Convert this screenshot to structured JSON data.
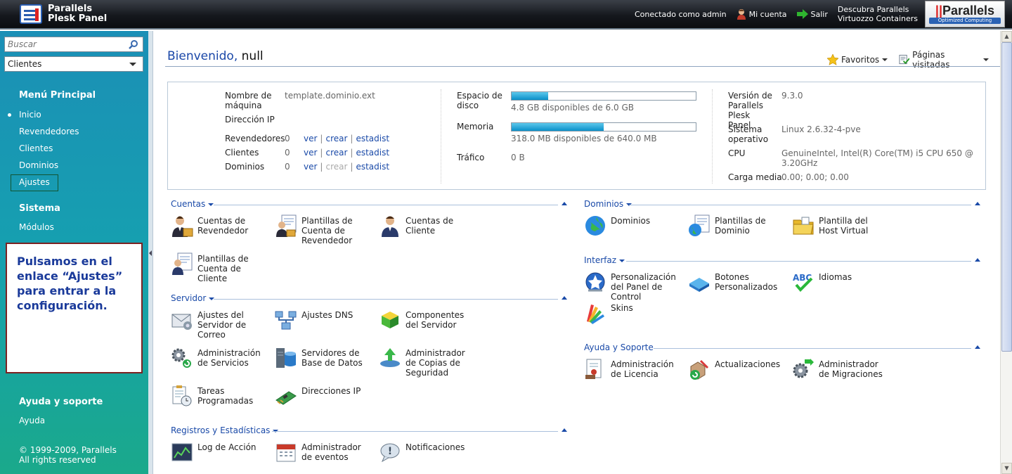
{
  "app": {
    "title_line1": "Parallels",
    "title_line2": "Plesk Panel"
  },
  "topbar": {
    "connected": "Conectado como admin",
    "account": "Mi cuenta",
    "logout": "Salir",
    "discover_line1": "Descubra Parallels",
    "discover_line2": "Virtuozzo Containers",
    "brand_name": "Parallels",
    "brand_tag": "Optimized Computing"
  },
  "sidebar": {
    "search_placeholder": "Buscar",
    "select_value": "Clientes",
    "main_menu": "Menú Principal",
    "main_items": [
      "Inicio",
      "Revendedores",
      "Clientes",
      "Dominios",
      "Ajustes"
    ],
    "system": "Sistema",
    "system_items": [
      "Módulos"
    ],
    "note": "Pulsamos en el enlace “Ajustes” para entrar a la configuración.",
    "help": "Ayuda y soporte",
    "help_items": [
      "Ayuda"
    ],
    "copyright_line1": "© 1999-2009, Parallels",
    "copyright_line2": "All rights reserved"
  },
  "main": {
    "welcome": "Bienvenido,",
    "user": "null",
    "favorites": "Favoritos",
    "visited": "Páginas visitadas"
  },
  "info": {
    "host_label": "Nombre de máquina",
    "host_value": "template.dominio.ext",
    "ip_label": "Dirección IP",
    "rows": [
      {
        "label": "Revendedores",
        "count": "0",
        "ver": "ver",
        "crear": "crear",
        "estadist": "estadist"
      },
      {
        "label": "Clientes",
        "count": "0",
        "ver": "ver",
        "crear": "crear",
        "estadist": "estadist"
      },
      {
        "label": "Dominios",
        "count": "0",
        "ver": "ver",
        "crear": "crear",
        "estadist": "estadist"
      }
    ],
    "disk_label": "Espacio de disco",
    "disk_value": "4.8 GB disponibles de 6.0 GB",
    "disk_used_fraction": 0.2,
    "mem_label": "Memoria",
    "mem_value": "318.0 MB disponibles de 640.0 MB",
    "mem_used_fraction": 0.5,
    "traffic_label": "Tráfico",
    "traffic_value": "0 B",
    "version_label": "Versión de Parallels Plesk Panel",
    "version_value": "9.3.0",
    "os_label": "Sistema operativo",
    "os_value": "Linux 2.6.32-4-pve",
    "cpu_label": "CPU",
    "cpu_value": "GenuineIntel, Intel(R) Core(TM) i5 CPU 650 @ 3.20GHz",
    "load_label": "Carga media",
    "load_value": "0.00; 0.00; 0.00"
  },
  "sections": {
    "cuentas": {
      "title": "Cuentas",
      "items": [
        "Cuentas de Revendedor",
        "Plantillas de Cuenta de Revendedor",
        "Cuentas de Cliente",
        "Plantillas de Cuenta de Cliente"
      ]
    },
    "servidor": {
      "title": "Servidor",
      "items": [
        "Ajustes del Servidor de Correo",
        "Ajustes DNS",
        "Componentes del Servidor",
        "Administración de Servicios",
        "Servidores de Base de Datos",
        "Administrador de Copias de Seguridad",
        "Tareas Programadas",
        "Direcciones IP"
      ]
    },
    "registros": {
      "title": "Registros y Estadísticas",
      "items": [
        "Log de Acción",
        "Administrador de eventos",
        "Notificaciones"
      ]
    },
    "dominios": {
      "title": "Dominios",
      "items": [
        "Dominios",
        "Plantillas de Dominio",
        "Plantilla del Host Virtual"
      ]
    },
    "interfaz": {
      "title": "Interfaz",
      "items": [
        "Personalización del Panel de Control",
        "Botones Personalizados",
        "Idiomas",
        "Skins"
      ]
    },
    "ayuda": {
      "title": "Ayuda y Soporte",
      "items": [
        "Administración de Licencia",
        "Actualizaciones",
        "Administrador de Migraciones"
      ]
    }
  }
}
